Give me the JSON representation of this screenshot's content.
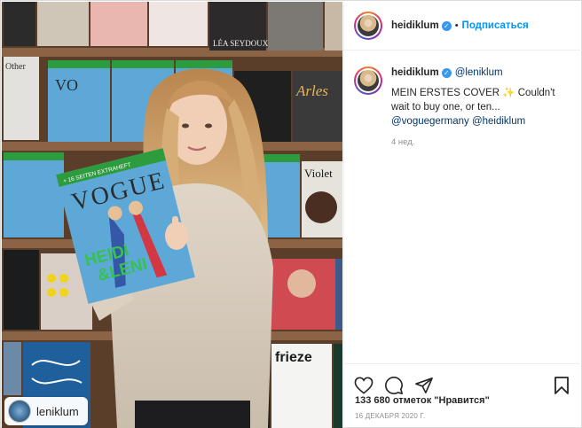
{
  "post": {
    "author": {
      "username": "heidiklum",
      "verified": true,
      "follow_label": "Подписаться"
    },
    "caption": {
      "username": "heidiklum",
      "mention": "@leniklum",
      "line1": "MEIN ERSTES COVER ✨ Couldn't wait to buy one, or ten... ",
      "mention_vogue": "@voguegermany",
      "mention_heidi": "@heidiklum",
      "time_ago": "4 нед."
    },
    "tag": {
      "username": "leniklum"
    },
    "likes": "133 680 отметок \"Нравится\"",
    "date": "16 ДЕКАБРЯ 2020 Г.",
    "photo": {
      "magazine_texts": [
        "VOGUE",
        "HEIDI & LENI",
        "Arles",
        "Violet",
        "frieze",
        "Other",
        "LÉA SEYDOUX"
      ],
      "cover_banner": "+ 16 SEITEN EXTRAHEFT JAHRESHOROSKOP 2021"
    },
    "icons": {
      "like": "heart-icon",
      "comment": "comment-icon",
      "share": "share-icon",
      "save": "bookmark-icon",
      "verified": "verified-badge-icon"
    },
    "colors": {
      "link": "#0095f6",
      "mention": "#00376b",
      "muted": "#8e8e8e"
    }
  }
}
